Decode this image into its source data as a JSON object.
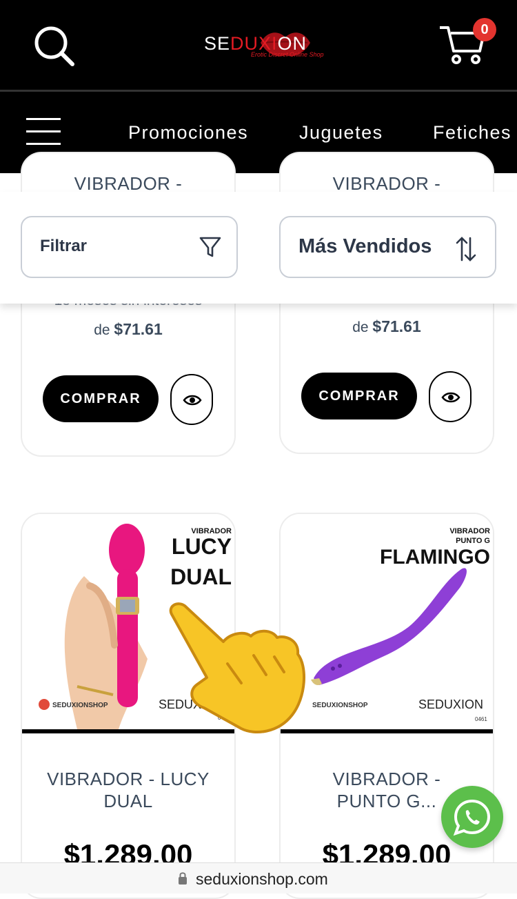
{
  "header": {
    "logo_main_a": "SE",
    "logo_main_b": "DUXI",
    "logo_main_c": "ON",
    "logo_sub": "Erotic Discret Online Shop",
    "cart_count": "0",
    "icons": [
      "search-icon",
      "cart-icon",
      "menu-icon"
    ]
  },
  "nav": {
    "items": [
      "Promociones",
      "Juguetes",
      "Fetiches"
    ]
  },
  "filters": {
    "filter_label": "Filtrar",
    "sort_label": "Más Vendidos"
  },
  "top_cards": [
    {
      "title": "VIBRADOR -",
      "installments_partial": "18 meses sin intereses",
      "price_prefix": "de",
      "price": "$71.61",
      "buy_label": "COMPRAR"
    },
    {
      "title": "VIBRADOR -",
      "price_prefix": "de",
      "price": "$71.61",
      "buy_label": "COMPRAR"
    }
  ],
  "products": [
    {
      "title_line1": "VIBRADOR - LUCY",
      "title_line2": "DUAL",
      "price": "$1,289.00",
      "image_label_small": "VIBRADOR",
      "image_label_1": "LUCY",
      "image_label_2": "DUAL",
      "image_brand": "SEDUXION",
      "image_social": "SEDUXIONSHOP",
      "image_code": "0465"
    },
    {
      "title_line1": "VIBRADOR -",
      "title_line2": "PUNTO G...",
      "price": "$1,289.00",
      "image_label_small_1": "VIBRADOR",
      "image_label_small_2": "PUNTO G",
      "image_label_1": "FLAMINGO",
      "image_brand": "SEDUXION",
      "image_social": "SEDUXIONSHOP",
      "image_code": "0461"
    }
  ],
  "browser": {
    "url": "seduxionshop.com"
  },
  "colors": {
    "brand_red": "#e31b23",
    "header_bg": "#000000",
    "whatsapp_green": "#5cbf4b",
    "product_pink": "#e8177f",
    "product_purple": "#8e3fd6"
  }
}
